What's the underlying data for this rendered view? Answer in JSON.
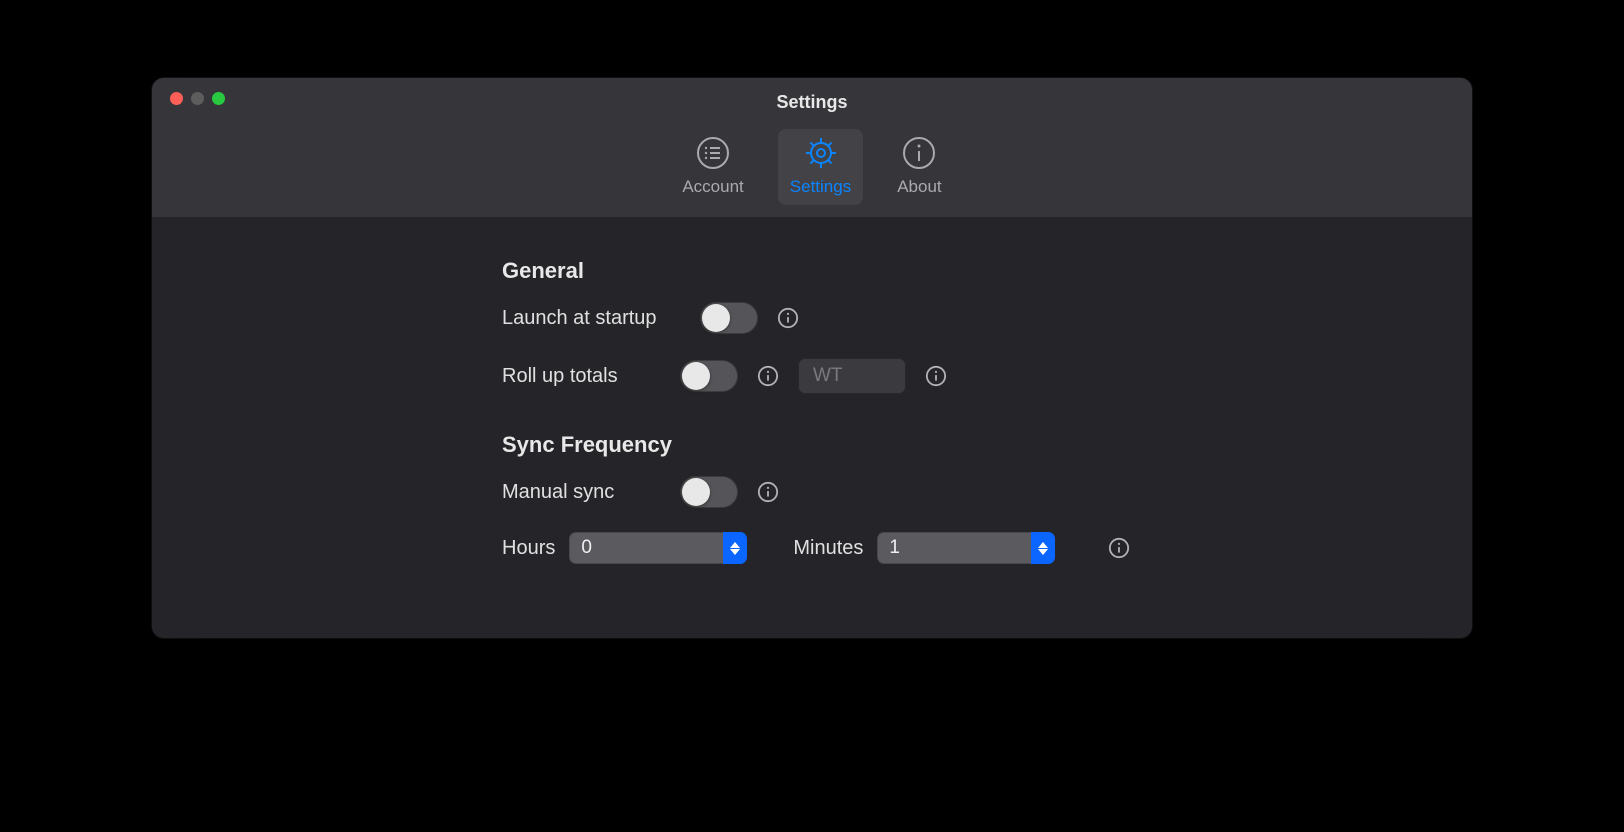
{
  "window": {
    "title": "Settings"
  },
  "toolbar": {
    "account": "Account",
    "settings": "Settings",
    "about": "About"
  },
  "general": {
    "heading": "General",
    "launch_label": "Launch at startup",
    "rollup_label": "Roll up totals",
    "rollup_placeholder": "WT"
  },
  "sync": {
    "heading": "Sync Frequency",
    "manual_label": "Manual sync",
    "hours_label": "Hours",
    "hours_value": "0",
    "minutes_label": "Minutes",
    "minutes_value": "1"
  }
}
